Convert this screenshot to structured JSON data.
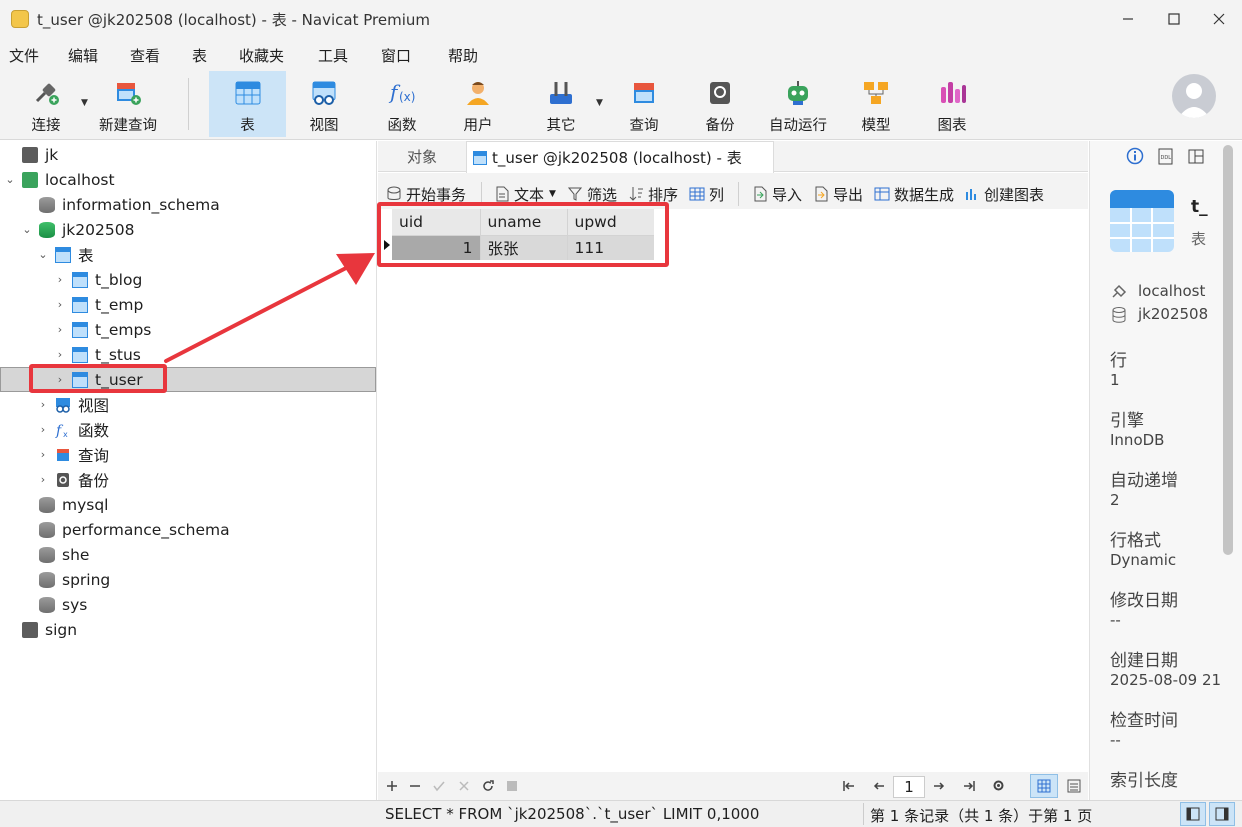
{
  "window": {
    "title": "t_user @jk202508 (localhost) - 表 - Navicat Premium"
  },
  "menu": [
    "文件",
    "编辑",
    "查看",
    "表",
    "收藏夹",
    "工具",
    "窗口",
    "帮助"
  ],
  "toolbar": {
    "connect": "连接",
    "new_query": "新建查询",
    "table": "表",
    "view": "视图",
    "function": "函数",
    "user": "用户",
    "other": "其它",
    "query": "查询",
    "backup": "备份",
    "automation": "自动运行",
    "model": "模型",
    "chart": "图表"
  },
  "tree": {
    "jk": "jk",
    "localhost": "localhost",
    "information_schema": "information_schema",
    "jk202508": "jk202508",
    "tables": "表",
    "t_blog": "t_blog",
    "t_emp": "t_emp",
    "t_emps": "t_emps",
    "t_stus": "t_stus",
    "t_user": "t_user",
    "views": "视图",
    "functions": "函数",
    "queries": "查询",
    "backups": "备份",
    "mysql": "mysql",
    "performance_schema": "performance_schema",
    "she": "she",
    "spring": "spring",
    "sys": "sys",
    "sign": "sign"
  },
  "tabs": {
    "objects": "对象",
    "active": "t_user @jk202508 (localhost) - 表"
  },
  "subtoolbar": {
    "begin_tx": "开始事务",
    "text": "文本",
    "filter": "筛选",
    "sort": "排序",
    "columns": "列",
    "import": "导入",
    "export": "导出",
    "data_gen": "数据生成",
    "create_chart": "创建图表"
  },
  "grid": {
    "columns": [
      "uid",
      "uname",
      "upwd"
    ],
    "rows": [
      [
        "1",
        "张张",
        "111"
      ]
    ]
  },
  "pagination": {
    "page": "1"
  },
  "status": {
    "sql": "SELECT * FROM `jk202508`.`t_user` LIMIT 0,1000",
    "records": "第 1 条记录（共 1 条）于第 1 页"
  },
  "info": {
    "name": "t_",
    "type": "表",
    "connection": "localhost",
    "database": "jk202508",
    "rows_label": "行",
    "rows_value": "1",
    "engine_label": "引擎",
    "engine_value": "InnoDB",
    "auto_inc_label": "自动递增",
    "auto_inc_value": "2",
    "row_format_label": "行格式",
    "row_format_value": "Dynamic",
    "modified_label": "修改日期",
    "modified_value": "--",
    "created_label": "创建日期",
    "created_value": "2025-08-09 21:",
    "checked_label": "检查时间",
    "checked_value": "--",
    "index_len_label": "索引长度"
  },
  "colors": {
    "accent": "#2e8be0",
    "annotation": "#e8363d",
    "selected_tool": "#cce4f7"
  }
}
